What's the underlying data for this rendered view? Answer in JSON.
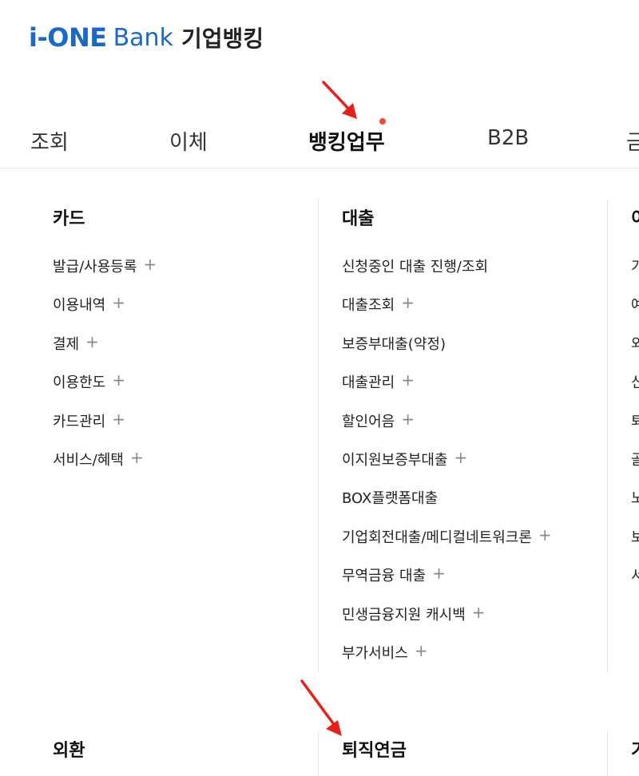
{
  "logo": {
    "ione": "i-ONE",
    "bank": "Bank",
    "corp": "기업뱅킹"
  },
  "tabs": [
    "조회",
    "이체",
    "뱅킹업무",
    "B2B",
    "금"
  ],
  "columns": [
    {
      "title": "카드",
      "items": [
        {
          "label": "발급/사용등록",
          "plus": true
        },
        {
          "label": "이용내역",
          "plus": true
        },
        {
          "label": "결제",
          "plus": true
        },
        {
          "label": "이용한도",
          "plus": true
        },
        {
          "label": "카드관리",
          "plus": true
        },
        {
          "label": "서비스/혜택",
          "plus": true
        }
      ]
    },
    {
      "title": "대출",
      "items": [
        {
          "label": "신청중인 대출 진행/조회",
          "plus": false
        },
        {
          "label": "대출조회",
          "plus": true
        },
        {
          "label": "보증부대출(약정)",
          "plus": false
        },
        {
          "label": "대출관리",
          "plus": true
        },
        {
          "label": "할인어음",
          "plus": true
        },
        {
          "label": "이지원보증부대출",
          "plus": true
        },
        {
          "label": "BOX플랫폼대출",
          "plus": false
        },
        {
          "label": "기업회전대출/메디컬네트워크론",
          "plus": true
        },
        {
          "label": "무역금융 대출",
          "plus": true
        },
        {
          "label": "민생금융지원 캐시백",
          "plus": true
        },
        {
          "label": "부가서비스",
          "plus": true
        }
      ]
    },
    {
      "title": "이",
      "items": [
        {
          "label": "가"
        },
        {
          "label": "예"
        },
        {
          "label": "외"
        },
        {
          "label": "신"
        },
        {
          "label": "퇴"
        },
        {
          "label": "골"
        },
        {
          "label": "노"
        },
        {
          "label": "보"
        },
        {
          "label": "서"
        }
      ]
    }
  ],
  "bottom_titles": [
    "외환",
    "퇴직연금",
    "기"
  ],
  "plus_symbol": "+",
  "colors": {
    "brand_blue": "#1a68c8",
    "brand_red": "#e5362c",
    "annotation_red": "#e8201a",
    "dot": "#f04a36"
  }
}
